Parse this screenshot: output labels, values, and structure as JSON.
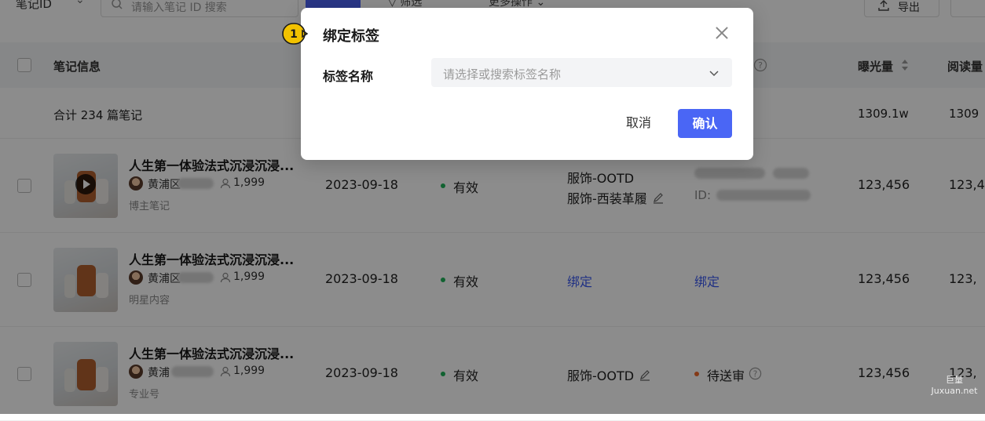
{
  "toolbar": {
    "field_select": "笔记ID",
    "search_placeholder": "请输入笔记 ID 搜索",
    "filter_label": "筛选",
    "more_label": "更多操作",
    "export_label": "导出"
  },
  "table": {
    "headers": {
      "note_info": "笔记信息",
      "exposure": "曝光量",
      "reads": "阅读量"
    },
    "summary": {
      "label": "合计 234 篇笔记",
      "exposure": "1309.1w",
      "reads": "1309"
    },
    "rows": [
      {
        "title": "人生第一体验法式沉浸沉浸...",
        "author": "黄浦区",
        "fans": "1,999",
        "type": "博主笔记",
        "date": "2023-09-18",
        "status": "有效",
        "tag_line1": "服饰-OOTD",
        "tag_line2": "服饰-西装革履",
        "col5_sub": "ID:",
        "exposure": "123,456",
        "reads": "123,4"
      },
      {
        "title": "人生第一体验法式沉浸沉浸...",
        "author": "黄浦区",
        "fans": "1,999",
        "type": "明星内容",
        "date": "2023-09-18",
        "status": "有效",
        "bind_tag": "绑定",
        "bind_col5": "绑定",
        "exposure": "123,456",
        "reads": "123,"
      },
      {
        "title": "人生第一体验法式沉浸沉浸...",
        "author": "黄浦",
        "fans": "1,999",
        "type": "专业号",
        "date": "2023-09-18",
        "status": "有效",
        "tag_line1": "服饰-OOTD",
        "col5_status": "待送审",
        "exposure": "123,456",
        "reads": "123,"
      }
    ]
  },
  "modal": {
    "step_number": "1",
    "title": "绑定标签",
    "field_label": "标签名称",
    "select_placeholder": "请选择或搜索标签名称",
    "cancel_label": "取消",
    "confirm_label": "确认"
  },
  "watermark": {
    "line1": "巨量",
    "line2": "Juxuan.net"
  },
  "colors": {
    "primary": "#4a66f5",
    "status_valid": "#1fb35a",
    "status_pending": "#f06a2b"
  }
}
